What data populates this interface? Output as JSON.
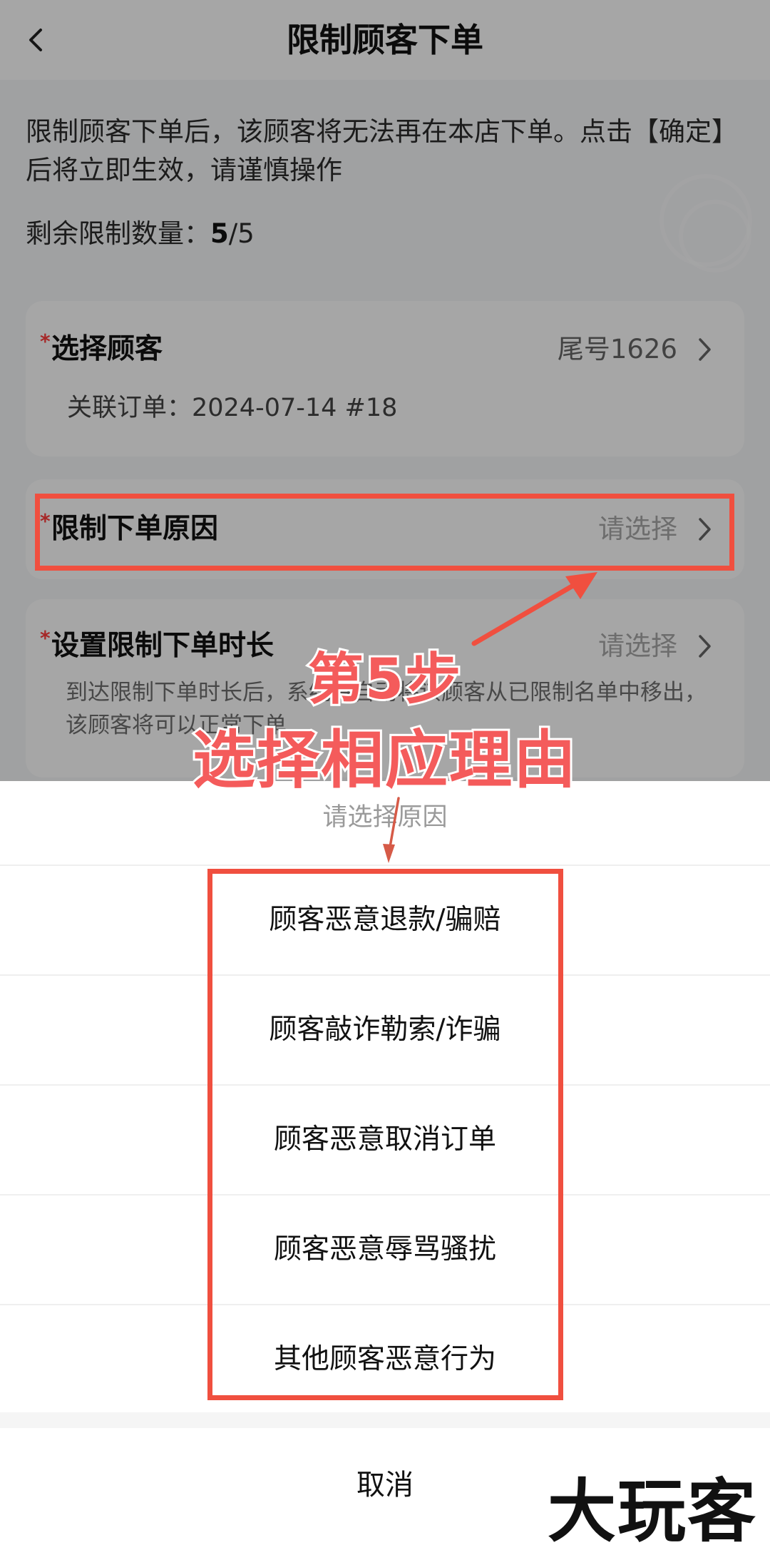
{
  "header": {
    "title": "限制顾客下单"
  },
  "intro": {
    "text": "限制顾客下单后，该顾客将无法再在本店下单。点击【确定】后将立即生效，请谨慎操作",
    "quota_label": "剩余限制数量：",
    "quota_current": "5",
    "quota_total": "/5"
  },
  "form": {
    "required_mark": "*",
    "customer": {
      "label": "选择顾客",
      "value": "尾号1626",
      "linked_order": "关联订单：2024-07-14 #18"
    },
    "reason": {
      "label": "限制下单原因",
      "placeholder": "请选择"
    },
    "duration": {
      "label": "设置限制下单时长",
      "placeholder": "请选择",
      "note": "到达限制下单时长后，系统将自动将该顾客从已限制名单中移出，该顾客将可以正常下单"
    }
  },
  "sheet": {
    "title": "请选择原因",
    "options": [
      "顾客恶意退款/骗赔",
      "顾客敲诈勒索/诈骗",
      "顾客恶意取消订单",
      "顾客恶意辱骂骚扰",
      "其他顾客恶意行为"
    ],
    "cancel_label": "取消"
  },
  "annotation": {
    "step": "第5步",
    "instruction": "选择相应理由"
  },
  "logo": {
    "text": "大玩客"
  },
  "colors": {
    "accent_red": "#f04f3f",
    "required_red": "#ff3e3e",
    "overlay": "#000000"
  },
  "icons": {
    "back": "chevron-left-icon",
    "forward": "chevron-right-icon"
  }
}
